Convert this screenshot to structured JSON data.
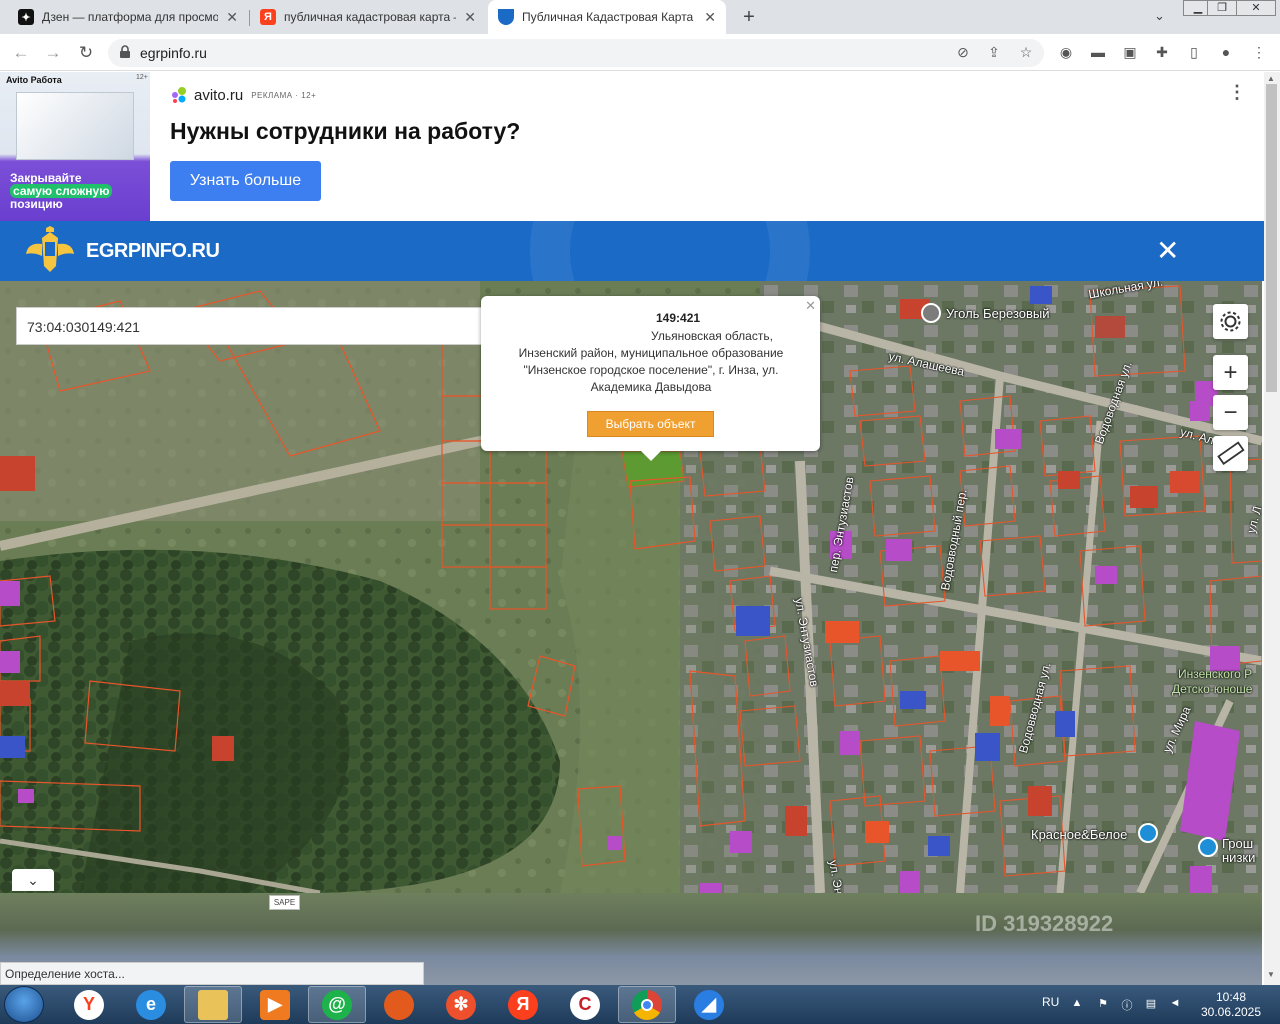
{
  "tabs": [
    {
      "title": "Дзен — платформа для просмотра",
      "active": false,
      "favicon": "dzen-icon"
    },
    {
      "title": "публичная кадастровая карта — Яндекс",
      "active": false,
      "favicon": "yandex-icon"
    },
    {
      "title": "Публичная Кадастровая Карта Росреестра",
      "active": true,
      "favicon": "shield-icon"
    }
  ],
  "new_tab_label": "+",
  "url": "egrpinfo.ru",
  "ad": {
    "image_brand": "Avito Работа",
    "image_age": "12+",
    "image_text_1": "Закрывайте",
    "image_text_2": "самую сложную",
    "image_text_3": "позицию",
    "source": "avito.ru",
    "ad_mark": "РЕКЛАМА · 12+",
    "headline": "Нужны сотрудники на работу?",
    "cta": "Узнать больше"
  },
  "site": {
    "title": "EGRPINFO.RU",
    "close_label": "✕"
  },
  "map": {
    "search_value": "73:04:030149:421",
    "clear_label": "×",
    "popup": {
      "number": "149:421",
      "address_line1": "Ульяновская область,",
      "address_rest": "Инзенский район, муниципальное образование \"Инзенское городское поселение\", г. Инза, ул. Академика Давыдова",
      "select_button": "Выбрать объект"
    },
    "zoom_in": "+",
    "zoom_out": "−",
    "labels": {
      "poi_coal": "Уголь Березовый",
      "street_shkolnaya": "Школьная ул.",
      "street_alasheeva": "ул. Алашеева",
      "street_vodovodnaya": "Водоводная ул.",
      "street_vodovodny_per": "Водовводный пер.",
      "street_entuziastov_per": "пер. Энтузиастов",
      "street_entuziastov": "ул. Энтузиастов",
      "street_entuziastov2": "ул. Эн",
      "street_vodovodnaya2": "Водовводная ул.",
      "street_mira": "ул. Мира",
      "street_al": "ул. Ал",
      "street_l": "ул. Л",
      "poi_krasnoe": "Красное&Белое",
      "poi_grosh_1": "Грош",
      "poi_grosh_2": "низки",
      "inzensk_1": "Инзенского Р",
      "inzensk_2": "Детско-юноше"
    }
  },
  "sape_label": "SAPE",
  "watermark": "ID 319328922",
  "status_text": "Определение хоста...",
  "tray": {
    "lang": "RU",
    "time": "10:48",
    "date": "30.06.2025"
  },
  "colors": {
    "header_blue": "#1a6ac6",
    "cta_blue": "#3d7ff0",
    "select_orange": "#f0a030",
    "parcel_red": "#e8552a",
    "selected_parcel": "#5aa02c"
  }
}
